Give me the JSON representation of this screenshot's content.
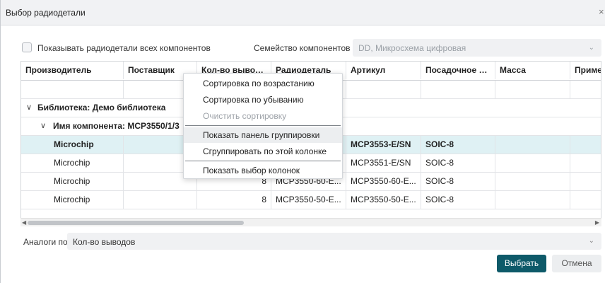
{
  "dialog": {
    "title": "Выбор радиодетали",
    "close_glyph": "×"
  },
  "options": {
    "show_all_label": "Показывать радиодетали всех компонентов",
    "show_all_checked": false,
    "family_label": "Семейство компонентов :",
    "family_value": "DD, Микросхема цифровая"
  },
  "grid": {
    "columns": [
      "Производитель",
      "Поставщик",
      "Кол-во выводов",
      "Радиодеталь",
      "Артикул",
      "Посадочное ме...",
      "Масса",
      "Примеч"
    ],
    "group_library": "Библиотека: Демо библиотека",
    "group_component": "Имя компонента: MCP3550/1/3",
    "rows": [
      {
        "manufacturer": "Microchip",
        "supplier": "",
        "pins": "",
        "part": "",
        "article": "MCP3553-E/SN",
        "footprint": "SOIC-8",
        "mass": "",
        "note": "",
        "selected": true
      },
      {
        "manufacturer": "Microchip",
        "supplier": "",
        "pins": "",
        "part": "",
        "article": "MCP3551-E/SN",
        "footprint": "SOIC-8",
        "mass": "",
        "note": "",
        "selected": false
      },
      {
        "manufacturer": "Microchip",
        "supplier": "",
        "pins": "8",
        "part": "MCP3550-60-E...",
        "article": "MCP3550-60-E...",
        "footprint": "SOIC-8",
        "mass": "",
        "note": "",
        "selected": false
      },
      {
        "manufacturer": "Microchip",
        "supplier": "",
        "pins": "8",
        "part": "MCP3550-50-E...",
        "article": "MCP3550-50-E...",
        "footprint": "SOIC-8",
        "mass": "",
        "note": "",
        "selected": false
      }
    ]
  },
  "context_menu": {
    "items": [
      {
        "label": "Сортировка по возрастанию",
        "disabled": false
      },
      {
        "label": "Сортировка по убыванию",
        "disabled": false
      },
      {
        "label": "Очистить сортировку",
        "disabled": true
      },
      {
        "label": "Показать панель группировки",
        "disabled": false,
        "highlighted": true
      },
      {
        "label": "Сгруппировать по этой колонке",
        "disabled": false
      },
      {
        "label": "Показать выбор колонок",
        "disabled": false
      }
    ]
  },
  "analogs": {
    "label": "Аналоги по:",
    "value": "Кол-во выводов"
  },
  "buttons": {
    "select": "Выбрать",
    "cancel": "Отмена"
  },
  "icons": {
    "chevron_down": "⌄",
    "expand": "∨",
    "scroll_left": "◀",
    "scroll_right": "▶"
  },
  "colors": {
    "accent": "#0e5a69",
    "selected_row": "#dff1f4"
  }
}
